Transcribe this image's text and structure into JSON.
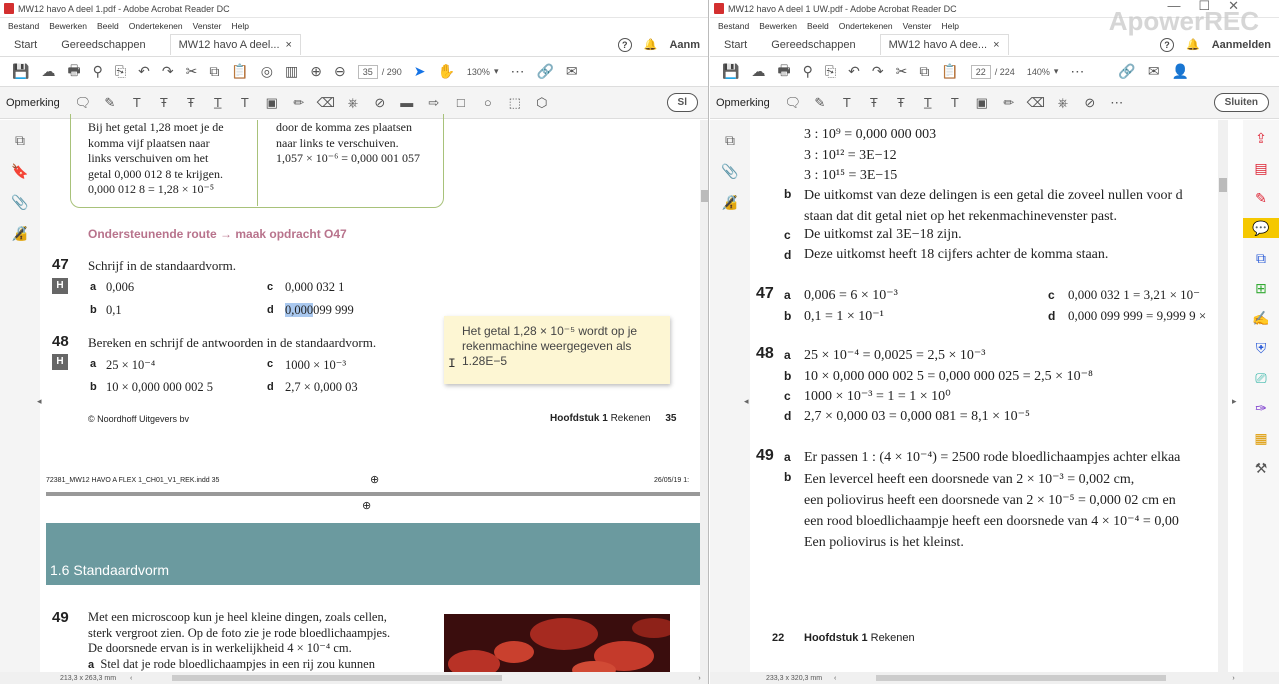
{
  "left": {
    "title": "MW12 havo A deel 1.pdf - Adobe Acrobat Reader DC",
    "menu": [
      "Bestand",
      "Bewerken",
      "Beeld",
      "Ondertekenen",
      "Venster",
      "Help"
    ],
    "tabs": {
      "start": "Start",
      "tools": "Gereedschappen",
      "doc": "MW12 havo A deel..."
    },
    "account": "Aanm",
    "toolbar": {
      "page": "35",
      "pages": "/ 290",
      "zoom": "130%"
    },
    "annot_label": "Opmerking",
    "sluiten": "Sl",
    "page": {
      "box_left": [
        "Bij het getal 1,28 moet je de",
        "komma vijf plaatsen naar",
        "links verschuiven om het",
        "getal 0,000 012 8 te krijgen.",
        "0,000 012 8 = 1,28 × 10⁻⁵"
      ],
      "box_right": [
        "door de komma zes plaatsen",
        "naar links te verschuiven.",
        "1,057 × 10⁻⁶ = 0,000 001 057"
      ],
      "route": "Ondersteunende route → maak opdracht O47",
      "q47": {
        "num": "47",
        "text": "Schrijf in de standaardvorm.",
        "h": "H",
        "a": "0,006",
        "b": "0,1",
        "c": "0,000 032 1",
        "d_hl": "0,000",
        "d_rest": "099 999"
      },
      "q48": {
        "num": "48",
        "text": "Bereken en schrijf de antwoorden in de standaardvorm.",
        "h": "H",
        "a": "25 × 10⁻⁴",
        "b": "10 × 0,000 000 002 5",
        "c": "1000 × 10⁻³",
        "d": "2,7 × 0,000 03"
      },
      "labels": {
        "a": "a",
        "b": "b",
        "c": "c",
        "d": "d"
      },
      "note": [
        "Het getal 1,28 × 10⁻⁵ wordt op je",
        "rekenmachine weergegeven als",
        "1.28E−5"
      ],
      "footer_left": "© Noordhoff Uitgevers bv",
      "footer_chap": "Hoofdstuk 1",
      "footer_chap_name": "Rekenen",
      "footer_page": "35",
      "slug_left": "72381_MW12 HAVO A FLEX 1_CH01_V1_REK.indd   35",
      "slug_right": "26/05/19   1:",
      "section": "1.6   Standaardvorm",
      "q49": {
        "num": "49",
        "lines": [
          "Met een microscoop kun je heel kleine dingen, zoals cellen,",
          "sterk vergroot zien. Op de foto zie je rode bloedlichaampjes.",
          "De doorsnede ervan is in werkelijkheid 4 × 10⁻⁴ cm."
        ],
        "a": "Stel dat je rode bloedlichaampjes in een rij zou kunnen"
      }
    },
    "status": "213,3 x 263,3 mm"
  },
  "right": {
    "title": "MW12 havo A deel 1 UW.pdf - Adobe Acrobat Reader DC",
    "menu": [
      "Bestand",
      "Bewerken",
      "Beeld",
      "Ondertekenen",
      "Venster",
      "Help"
    ],
    "tabs": {
      "start": "Start",
      "tools": "Gereedschappen",
      "doc": "MW12 havo A dee..."
    },
    "account": "Aanmelden",
    "toolbar": {
      "page": "22",
      "pages": "/ 224",
      "zoom": "140%"
    },
    "annot_label": "Opmerking",
    "sluiten": "Sluiten",
    "watermark": "ApowerREC",
    "page": {
      "top": [
        "3 : 10⁹ = 0,000 000 003",
        "3 : 10¹² = 3E−12",
        "3 : 10¹⁵ = 3E−15"
      ],
      "b1": [
        "De uitkomst van deze delingen is een getal die zoveel nullen voor d",
        "staan dat dit getal niet op het rekenmachinevenster past."
      ],
      "c1": "De uitkomst zal 3E−18 zijn.",
      "d1": "Deze uitkomst heeft 18 cijfers achter de komma staan.",
      "a47": {
        "num": "47",
        "a": "0,006 = 6 × 10⁻³",
        "b": "0,1 = 1 × 10⁻¹",
        "c": "0,000 032 1 = 3,21 × 10⁻",
        "d": "0,000 099 999 = 9,999 9 ×"
      },
      "a48": {
        "num": "48",
        "a": "25 × 10⁻⁴ = 0,0025 = 2,5 × 10⁻³",
        "b": "10 × 0,000 000 002 5 = 0,000 000 025 = 2,5 × 10⁻⁸",
        "c": "1000 × 10⁻³ = 1 = 1 × 10⁰",
        "d": "2,7 × 0,000 03 = 0,000 081 = 8,1 × 10⁻⁵"
      },
      "a49": {
        "num": "49",
        "a": "Er passen 1 : (4 × 10⁻⁴) = 2500 rode bloedlichaampjes achter elkaa",
        "b": [
          "Een levercel heeft een doorsnede van 2 × 10⁻³ = 0,002 cm,",
          "een poliovirus heeft een doorsnede van 2 × 10⁻⁵ = 0,000 02 cm en",
          "een rood bloedlichaampje heeft een doorsnede van 4 × 10⁻⁴ = 0,00",
          "Een poliovirus is het kleinst."
        ]
      },
      "labels": {
        "a": "a",
        "b": "b",
        "c": "c",
        "d": "d"
      },
      "footer_page": "22",
      "footer_chap": "Hoofdstuk 1",
      "footer_chap_name": "Rekenen"
    },
    "status": "233,3 x 320,3 mm"
  }
}
